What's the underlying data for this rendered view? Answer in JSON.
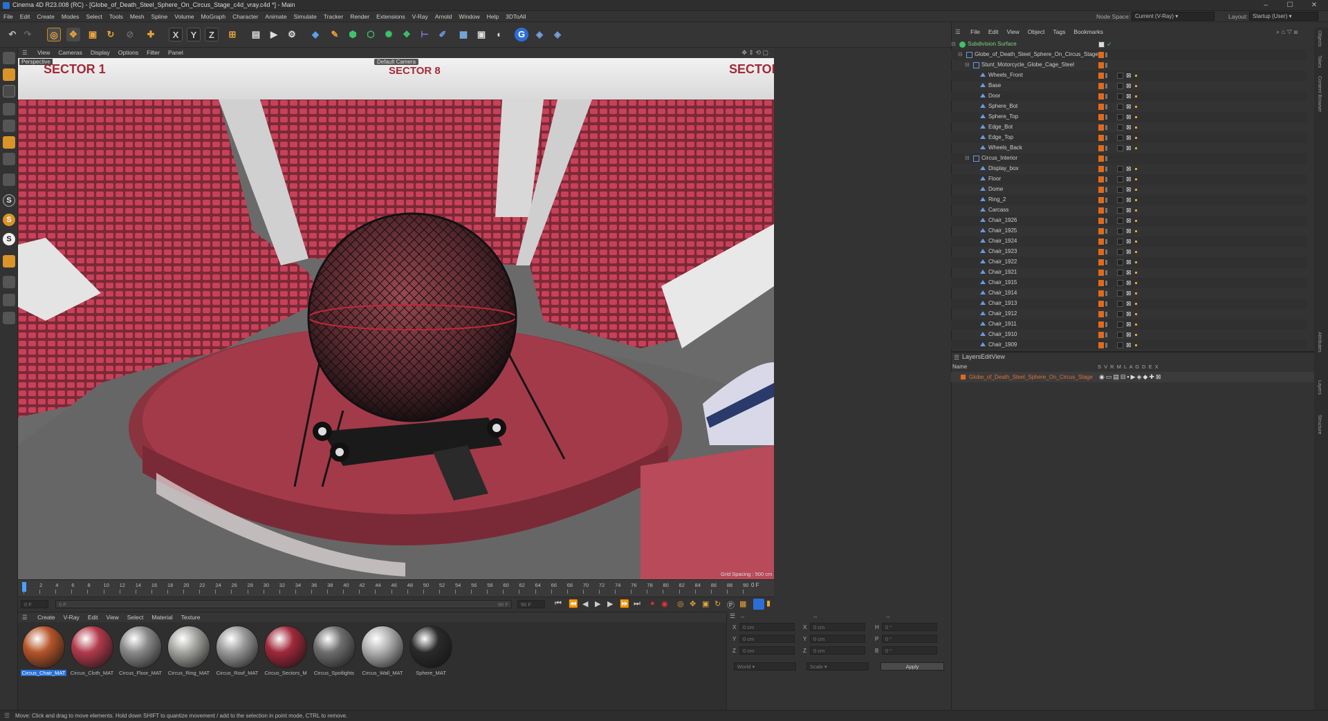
{
  "window": {
    "title": "Cinema 4D R23.008 (RC) - [Globe_of_Death_Steel_Sphere_On_Circus_Stage_c4d_vray.c4d *] - Main"
  },
  "menu": {
    "items": [
      "File",
      "Edit",
      "Create",
      "Modes",
      "Select",
      "Tools",
      "Mesh",
      "Spline",
      "Volume",
      "MoGraph",
      "Character",
      "Animate",
      "Simulate",
      "Tracker",
      "Render",
      "Extensions",
      "V-Ray",
      "Arnold",
      "Window",
      "Help",
      "3DToAll"
    ],
    "node_space_label": "Node Space:",
    "node_space_value": "Current (V-Ray)",
    "layout_label": "Layout:",
    "layout_value": "Startup (User)"
  },
  "toolbar": {
    "axis_x": "X",
    "axis_y": "Y",
    "axis_z": "Z"
  },
  "viewport": {
    "menu": [
      "View",
      "Cameras",
      "Display",
      "Options",
      "Filter",
      "Panel"
    ],
    "view_name": "Perspective",
    "camera_badge": "Default Camera",
    "grid_spacing": "Grid Spacing : 500 cm",
    "signs": [
      "SECTOR 1",
      "SECTOR 8",
      "SECTOR"
    ]
  },
  "timeline": {
    "ticks": [
      "0",
      "2",
      "4",
      "6",
      "8",
      "10",
      "12",
      "14",
      "16",
      "18",
      "20",
      "22",
      "24",
      "26",
      "28",
      "30",
      "32",
      "34",
      "36",
      "38",
      "40",
      "42",
      "44",
      "46",
      "48",
      "50",
      "52",
      "54",
      "56",
      "58",
      "60",
      "62",
      "64",
      "66",
      "68",
      "70",
      "72",
      "74",
      "76",
      "78",
      "80",
      "82",
      "84",
      "86",
      "88",
      "90"
    ],
    "current_frame": "0 F",
    "start_frame": "0 F",
    "start_frame_2": "0 F",
    "end_frame": "90 F",
    "end_frame_2": "90 F"
  },
  "materials": {
    "menu": [
      "Create",
      "V-Ray",
      "Edit",
      "View",
      "Select",
      "Material",
      "Texture"
    ],
    "items": [
      {
        "label": "Circus_Chair_MAT",
        "color": "#b5552a",
        "selected": true
      },
      {
        "label": "Circus_Cloth_MAT",
        "color": "#b23a4c",
        "selected": false
      },
      {
        "label": "Circus_Floor_MAT",
        "color": "#8a8a8a",
        "selected": false
      },
      {
        "label": "Circus_Ring_MAT",
        "color": "#a4a4a0",
        "selected": false
      },
      {
        "label": "Circus_Roof_MAT",
        "color": "#9a9a9a",
        "selected": false
      },
      {
        "label": "Circus_Sectors_M",
        "color": "#a0283a",
        "selected": false
      },
      {
        "label": "Circus_Spotlights",
        "color": "#6e6e6e",
        "selected": false
      },
      {
        "label": "Circus_Wall_MAT",
        "color": "#b0b0b0",
        "selected": false
      },
      {
        "label": "Sphere_MAT",
        "color": "#2a2a2a",
        "selected": false
      }
    ]
  },
  "coords": {
    "header": [
      "--",
      "--",
      "--"
    ],
    "rows": [
      {
        "a": "X",
        "av": "0 cm",
        "b": "X",
        "bv": "0 cm",
        "c": "H",
        "cv": "0 °"
      },
      {
        "a": "Y",
        "av": "0 cm",
        "b": "Y",
        "bv": "0 cm",
        "c": "P",
        "cv": "0 °"
      },
      {
        "a": "Z",
        "av": "0 cm",
        "b": "Z",
        "bv": "0 cm",
        "c": "B",
        "cv": "0 °"
      }
    ],
    "mode1": "World",
    "mode2": "Scale",
    "apply": "Apply"
  },
  "objects": {
    "menu": [
      "File",
      "Edit",
      "View",
      "Object",
      "Tags",
      "Bookmarks"
    ],
    "rows": [
      {
        "name": "Subdivision Surface",
        "indent": 0,
        "type": "subd",
        "tags": false
      },
      {
        "name": "Globe_of_Death_Steel_Sphere_On_Circus_Stage",
        "indent": 1,
        "type": "null",
        "tags": false
      },
      {
        "name": "Stunt_Motorcycle_Globe_Cage_Steel",
        "indent": 2,
        "type": "null",
        "tags": false
      },
      {
        "name": "Wheels_Front",
        "indent": 3,
        "type": "mesh",
        "tags": true
      },
      {
        "name": "Base",
        "indent": 3,
        "type": "mesh",
        "tags": true
      },
      {
        "name": "Door",
        "indent": 3,
        "type": "mesh",
        "tags": true
      },
      {
        "name": "Sphere_Bot",
        "indent": 3,
        "type": "mesh",
        "tags": true
      },
      {
        "name": "Sphere_Top",
        "indent": 3,
        "type": "mesh",
        "tags": true
      },
      {
        "name": "Edge_Bot",
        "indent": 3,
        "type": "mesh",
        "tags": true
      },
      {
        "name": "Edge_Top",
        "indent": 3,
        "type": "mesh",
        "tags": true
      },
      {
        "name": "Wheels_Back",
        "indent": 3,
        "type": "mesh",
        "tags": true
      },
      {
        "name": "Circus_Interior",
        "indent": 2,
        "type": "null",
        "tags": false
      },
      {
        "name": "Display_box",
        "indent": 3,
        "type": "mesh",
        "tags": true
      },
      {
        "name": "Floor",
        "indent": 3,
        "type": "mesh",
        "tags": true
      },
      {
        "name": "Dome",
        "indent": 3,
        "type": "mesh",
        "tags": true
      },
      {
        "name": "Ring_2",
        "indent": 3,
        "type": "mesh",
        "tags": true
      },
      {
        "name": "Carcass",
        "indent": 3,
        "type": "mesh",
        "tags": true
      },
      {
        "name": "Chair_1926",
        "indent": 3,
        "type": "mesh",
        "tags": true
      },
      {
        "name": "Chair_1925",
        "indent": 3,
        "type": "mesh",
        "tags": true
      },
      {
        "name": "Chair_1924",
        "indent": 3,
        "type": "mesh",
        "tags": true
      },
      {
        "name": "Chair_1923",
        "indent": 3,
        "type": "mesh",
        "tags": true
      },
      {
        "name": "Chair_1922",
        "indent": 3,
        "type": "mesh",
        "tags": true
      },
      {
        "name": "Chair_1921",
        "indent": 3,
        "type": "mesh",
        "tags": true
      },
      {
        "name": "Chair_1915",
        "indent": 3,
        "type": "mesh",
        "tags": true
      },
      {
        "name": "Chair_1914",
        "indent": 3,
        "type": "mesh",
        "tags": true
      },
      {
        "name": "Chair_1913",
        "indent": 3,
        "type": "mesh",
        "tags": true
      },
      {
        "name": "Chair_1912",
        "indent": 3,
        "type": "mesh",
        "tags": true
      },
      {
        "name": "Chair_1911",
        "indent": 3,
        "type": "mesh",
        "tags": true
      },
      {
        "name": "Chair_1910",
        "indent": 3,
        "type": "mesh",
        "tags": true
      },
      {
        "name": "Chair_1909",
        "indent": 3,
        "type": "mesh",
        "tags": true
      }
    ]
  },
  "layers": {
    "menu": [
      "Layers",
      "Edit",
      "View"
    ],
    "col_name": "Name",
    "col_flags": "S V R M L A G D E X",
    "row_name": "Globe_of_Death_Steel_Sphere_On_Circus_Stage"
  },
  "side_tabs": [
    "Objects",
    "Takes",
    "Content Browser",
    "Attributes",
    "Layers",
    "Structure"
  ],
  "status": "Move: Click and drag to move elements. Hold down SHIFT to quantize movement / add to the selection in point mode, CTRL to remove."
}
